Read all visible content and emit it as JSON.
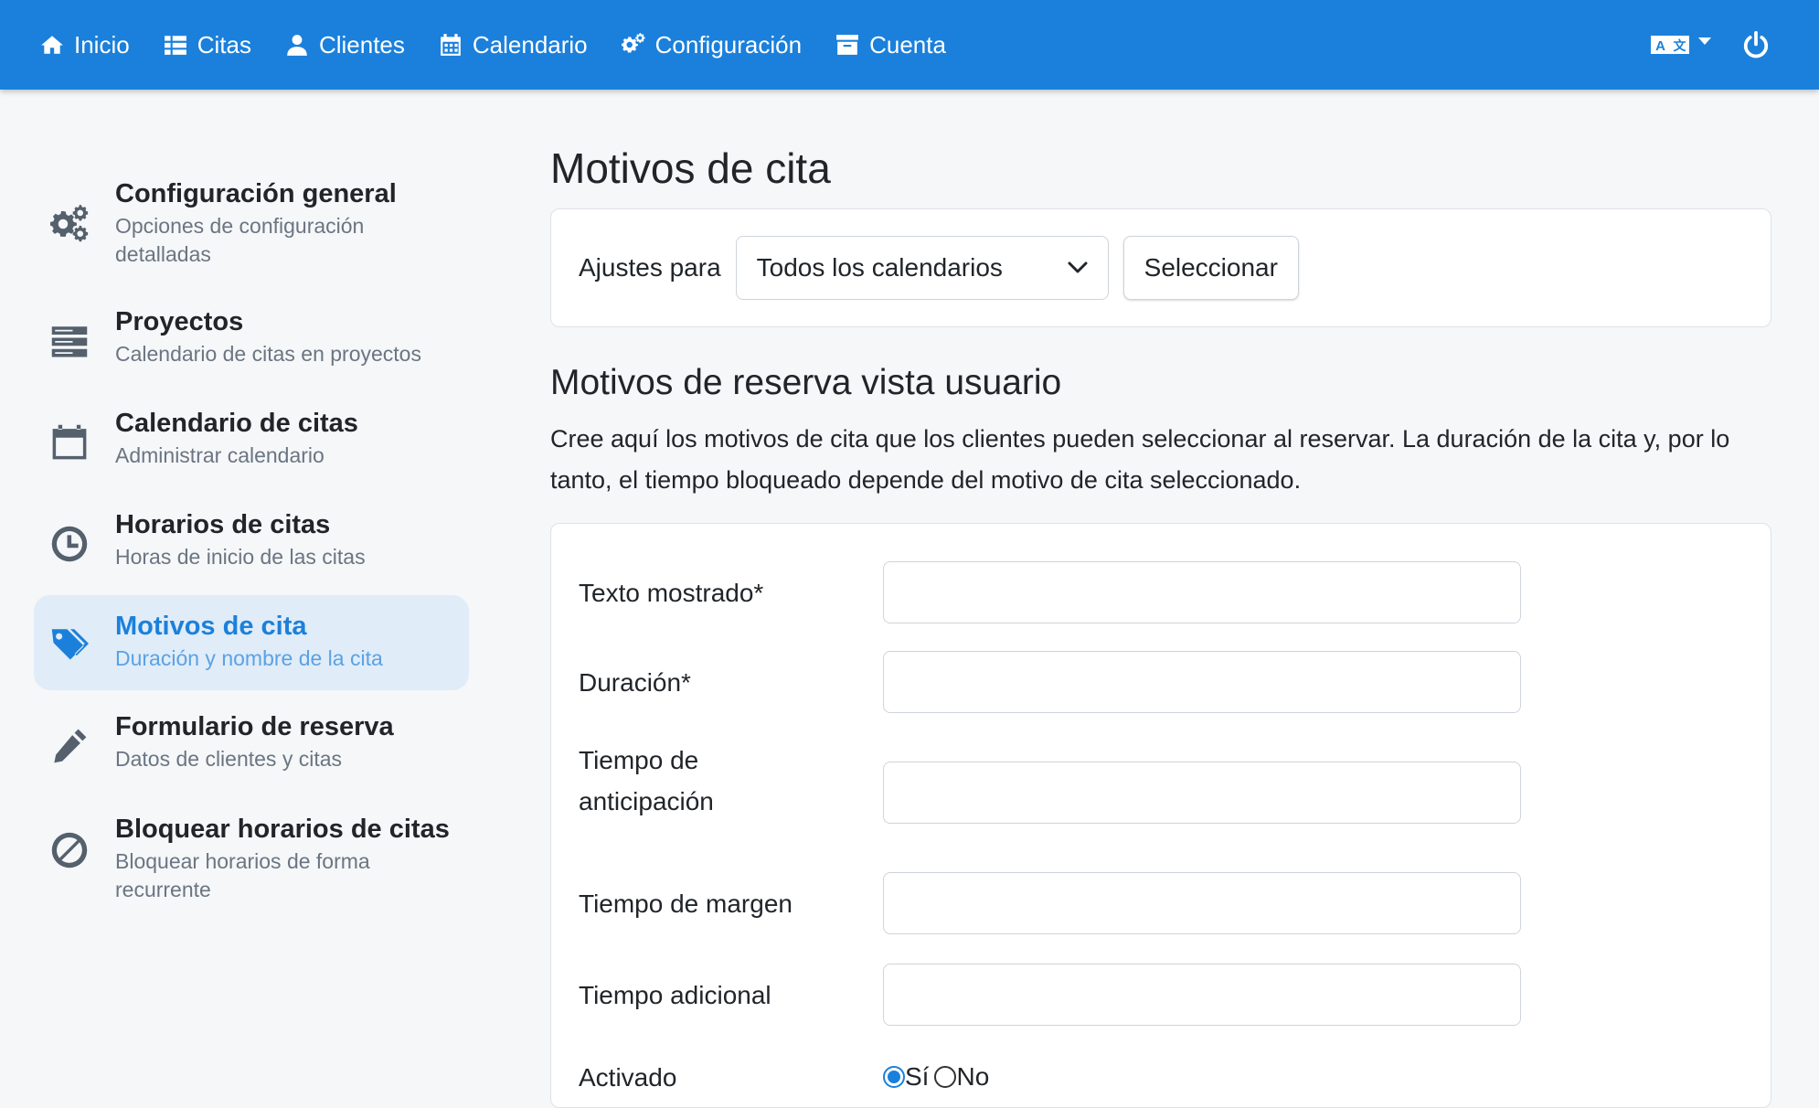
{
  "nav": {
    "items": [
      {
        "label": "Inicio",
        "icon": "home-icon"
      },
      {
        "label": "Citas",
        "icon": "list-icon"
      },
      {
        "label": "Clientes",
        "icon": "user-icon"
      },
      {
        "label": "Calendario",
        "icon": "calendar-icon"
      },
      {
        "label": "Configuración",
        "icon": "gears-icon"
      },
      {
        "label": "Cuenta",
        "icon": "archive-icon"
      }
    ],
    "language_icon": "language-icon",
    "power_icon": "power-icon",
    "bg_color": "#1b80db"
  },
  "sidebar": {
    "items": [
      {
        "title": "Configuración general",
        "sub_line1": "Opciones de configuración",
        "sub_line2": "detalladas",
        "icon": "gears-icon"
      },
      {
        "title": "Proyectos",
        "sub_line1": "Calendario de citas en proyectos",
        "sub_line2": "",
        "icon": "server-icon"
      },
      {
        "title": "Calendario de citas",
        "sub_line1": "Administrar calendario",
        "sub_line2": "",
        "icon": "calendar-icon"
      },
      {
        "title": "Horarios de citas",
        "sub_line1": "Horas de inicio de las citas",
        "sub_line2": "",
        "icon": "clock-icon"
      },
      {
        "title": "Motivos de cita",
        "sub_line1": "Duración y nombre de la cita",
        "sub_line2": "",
        "icon": "tags-icon",
        "active": true
      },
      {
        "title": "Formulario de reserva",
        "sub_line1": "Datos de clientes y citas",
        "sub_line2": "",
        "icon": "pencil-icon"
      },
      {
        "title": "Bloquear horarios de citas",
        "sub_line1": "Bloquear horarios de forma",
        "sub_line2": "recurrente",
        "icon": "ban-icon"
      }
    ],
    "active_color": "#1b80db"
  },
  "main": {
    "title": "Motivos de cita",
    "settings": {
      "label": "Ajustes para",
      "selected": "Todos los calendarios",
      "button": "Seleccionar"
    },
    "section_title": "Motivos de reserva vista usuario",
    "description": "Cree aquí los motivos de cita que los clientes pueden seleccionar al reservar. La duración de la cita y, por lo tanto, el tiempo bloqueado depende del motivo de cita seleccionado.",
    "form": {
      "fields": [
        {
          "label": "Texto mostrado*",
          "value": ""
        },
        {
          "label": "Duración*",
          "value": ""
        },
        {
          "label_line1": "Tiempo de",
          "label_line2": "anticipación",
          "value": ""
        },
        {
          "label": "Tiempo de margen",
          "value": ""
        },
        {
          "label": "Tiempo adicional",
          "value": ""
        }
      ],
      "activated": {
        "label": "Activado",
        "options": [
          "Sí",
          "No"
        ],
        "selected": "Sí"
      }
    }
  }
}
